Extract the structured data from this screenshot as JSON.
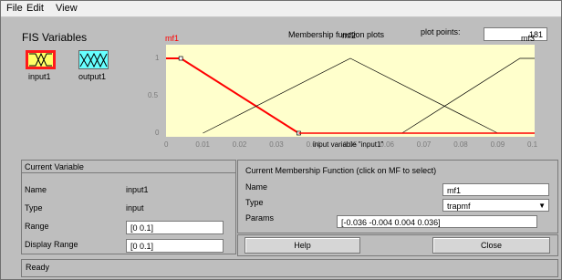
{
  "menu": {
    "items": [
      "File",
      "Edit",
      "View"
    ]
  },
  "fis": {
    "title": "FIS Variables",
    "input_label": "input1",
    "output_label": "output1"
  },
  "plot": {
    "header": "Membership function plots",
    "points_label": "plot points:",
    "points_value": "181",
    "xlabel": "input variable \"input1\"",
    "mf_labels": [
      "mf1",
      "mf2",
      "mf3"
    ],
    "y_ticks": [
      "0",
      "0.5",
      "1"
    ],
    "x_ticks": [
      "0",
      "0.01",
      "0.02",
      "0.03",
      "0.04",
      "0.05",
      "0.06",
      "0.07",
      "0.08",
      "0.09",
      "0.1"
    ],
    "colors": {
      "background": "#ffffcc",
      "selected": "#ff0000",
      "normal": "#000000"
    }
  },
  "chart_data": {
    "type": "line",
    "xlabel": "input variable \"input1\"",
    "xlim": [
      0,
      0.1
    ],
    "ylim": [
      0,
      1
    ],
    "series": [
      {
        "name": "mf1",
        "x": [
          -0.036,
          -0.004,
          0.004,
          0.036
        ],
        "y": [
          0,
          1,
          1,
          0
        ]
      },
      {
        "name": "mf2",
        "x": [
          0.01,
          0.05,
          0.09
        ],
        "y": [
          0,
          1,
          0
        ]
      },
      {
        "name": "mf3",
        "x": [
          0.064,
          0.096,
          0.104,
          0.136
        ],
        "y": [
          0,
          1,
          1,
          0
        ]
      }
    ]
  },
  "current_variable": {
    "title": "Current Variable",
    "name_label": "Name",
    "name_value": "input1",
    "type_label": "Type",
    "type_value": "input",
    "range_label": "Range",
    "range_value": "[0 0.1]",
    "display_range_label": "Display Range",
    "display_range_value": "[0 0.1]"
  },
  "current_mf": {
    "title": "Current Membership Function (click on MF to select)",
    "name_label": "Name",
    "name_value": "mf1",
    "type_label": "Type",
    "type_value": "trapmf",
    "params_label": "Params",
    "params_value": "[-0.036 -0.004 0.004 0.036]"
  },
  "buttons": {
    "help": "Help",
    "close": "Close"
  },
  "status": {
    "text": "Ready"
  }
}
